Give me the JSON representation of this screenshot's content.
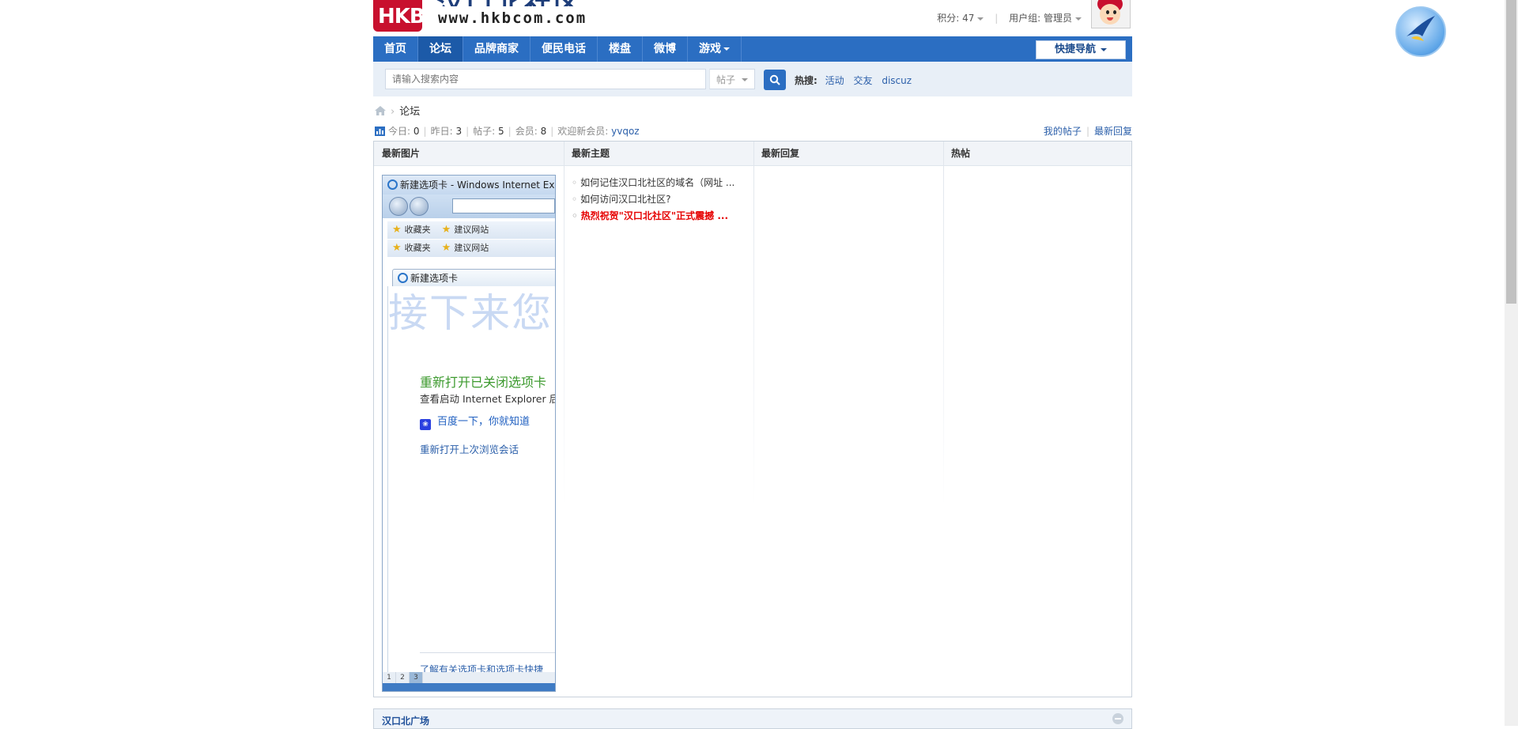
{
  "header": {
    "logo_abbr": "HKB",
    "logo_name": "汉口北社区",
    "logo_url": "www.hkbcom.com",
    "points_label": "积分: 47",
    "usergroup_label": "用户组: 管理员"
  },
  "nav": {
    "items": [
      {
        "label": "首页"
      },
      {
        "label": "论坛"
      },
      {
        "label": "品牌商家"
      },
      {
        "label": "便民电话"
      },
      {
        "label": "楼盘"
      },
      {
        "label": "微博"
      },
      {
        "label": "游戏"
      }
    ],
    "quick_nav": "快捷导航"
  },
  "search": {
    "placeholder": "请输入搜索内容",
    "type": "帖子",
    "hot_label": "热搜:",
    "hot_terms": [
      "活动",
      "交友",
      "discuz"
    ]
  },
  "breadcrumb": {
    "current": "论坛"
  },
  "stats": {
    "today_label": "今日:",
    "today": "0",
    "yesterday_label": "昨日:",
    "yesterday": "3",
    "posts_label": "帖子:",
    "posts": "5",
    "members_label": "会员:",
    "members": "8",
    "welcome_label": "欢迎新会员:",
    "newest_member": "yvqoz",
    "my_posts": "我的帖子",
    "latest_replies": "最新回复"
  },
  "grid": {
    "columns": [
      "最新图片",
      "最新主题",
      "最新回复",
      "热帖"
    ],
    "latest_topics": [
      {
        "title": "如何记住汉口北社区的域名（网址 ...",
        "highlight": false
      },
      {
        "title": "如何访问汉口北社区?",
        "highlight": false
      },
      {
        "title": "热烈祝贺\"汉口北社区\"正式震撼 ...",
        "highlight": true
      }
    ]
  },
  "picture": {
    "window_title": "新建选项卡 - Windows Internet Ex",
    "favorites": "收藏夹",
    "suggested_sites": "建议网站",
    "tab_label": "新建选项卡",
    "ghost_text": "接下来您",
    "reopen_closed": "重新打开已关闭选项卡",
    "reopen_sub": "查看启动 Internet Explorer 后",
    "baidu_link": "百度一下，你就知道",
    "reopen_last": "重新打开上次浏览会话",
    "learn_more": "了解有关选项卡和选项卡快捷",
    "pages": [
      "1",
      "2",
      "3"
    ]
  },
  "section": {
    "title": "汉口北广场"
  },
  "colors": {
    "nav_blue": "#2b6ec2",
    "link_blue": "#2b5faa",
    "highlight_red": "#e60000"
  }
}
